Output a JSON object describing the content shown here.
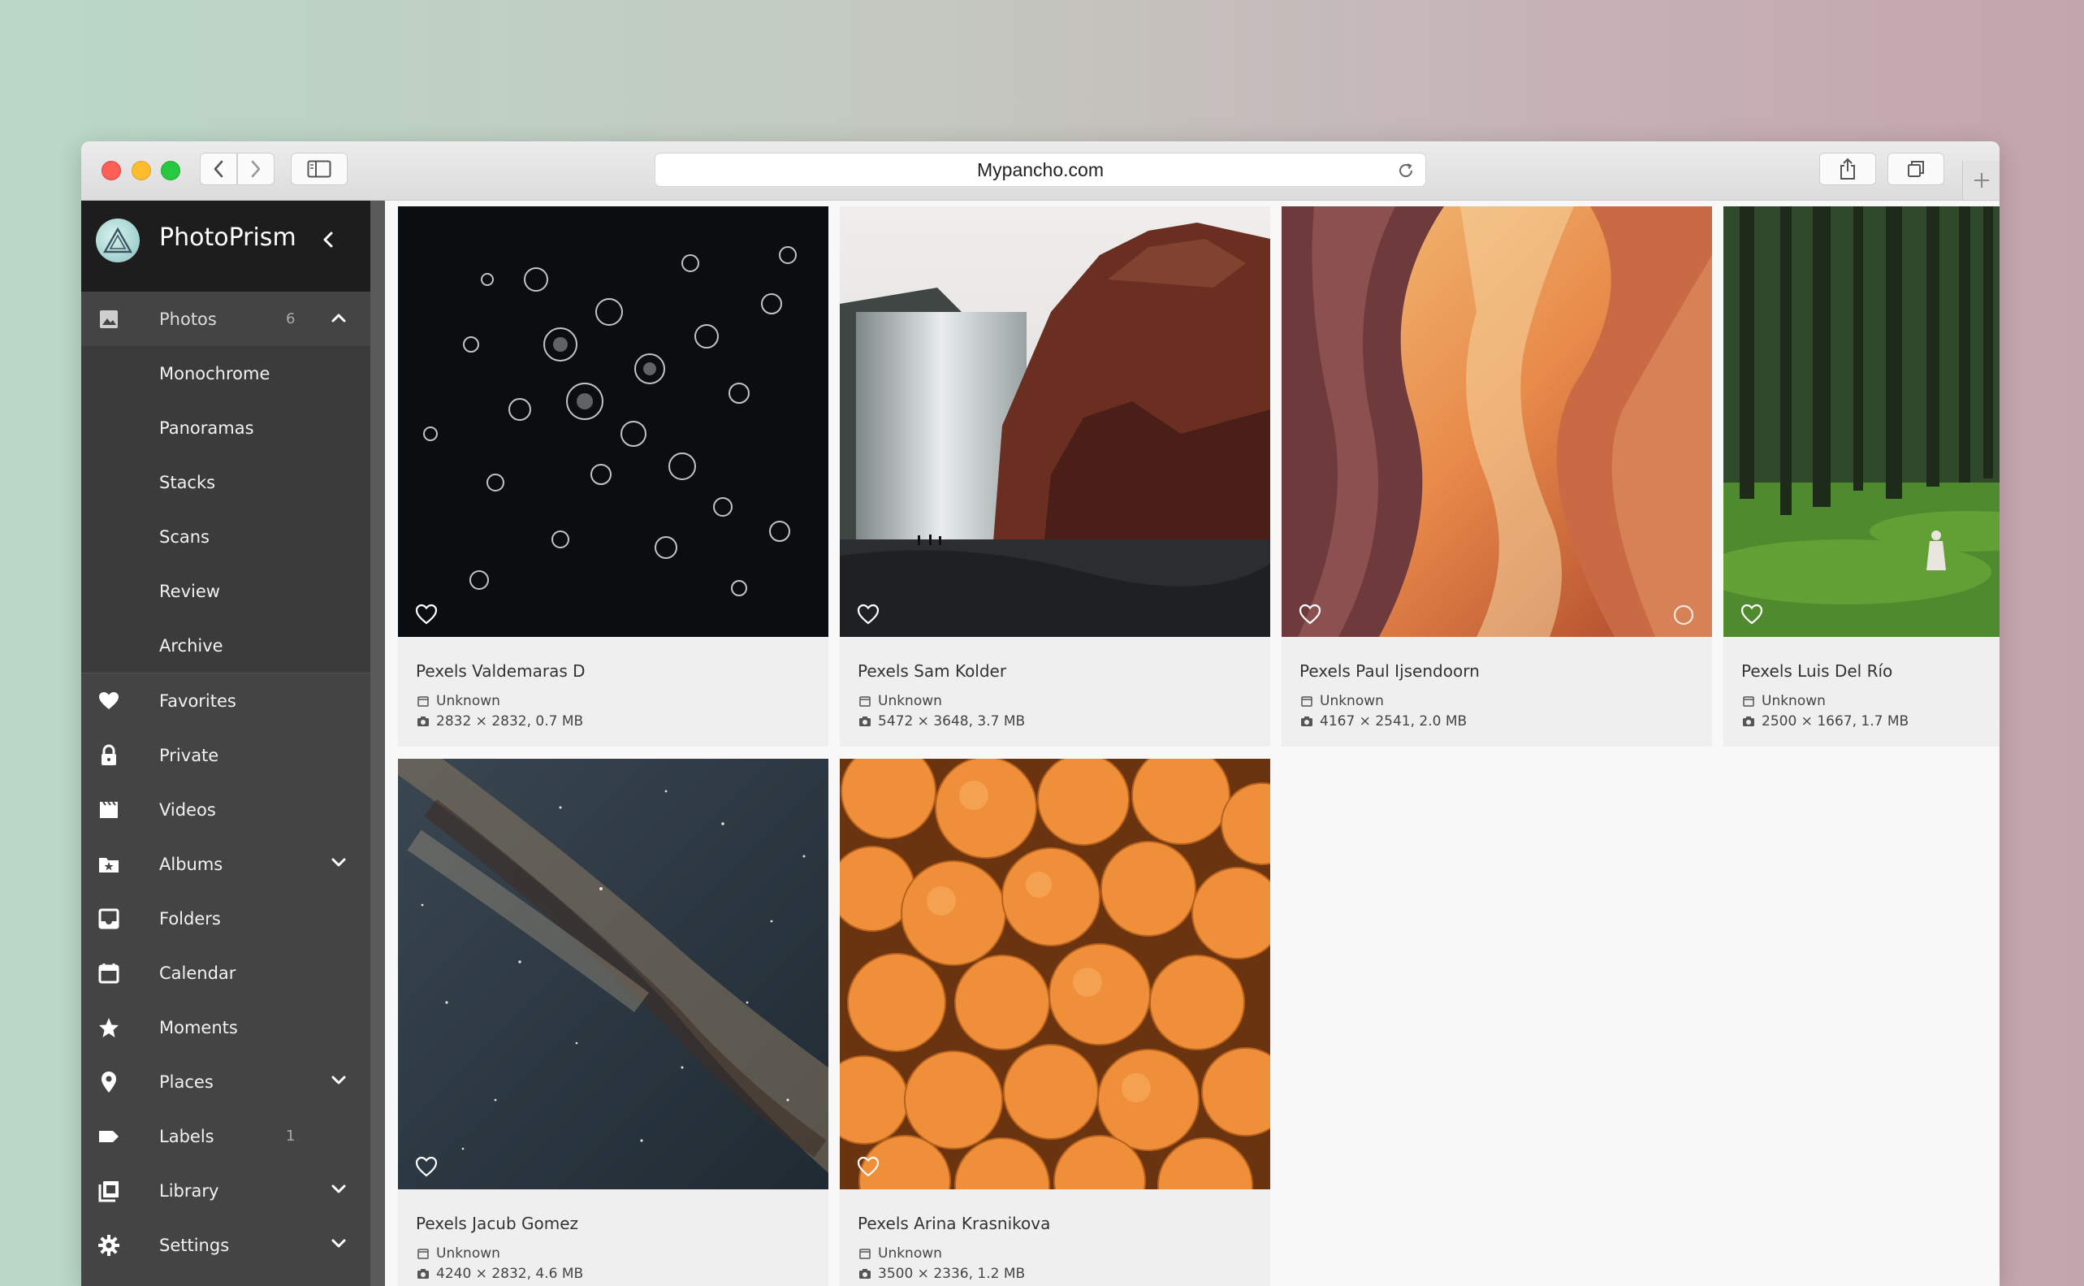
{
  "browser": {
    "url": "Mypancho.com"
  },
  "app": {
    "name": "PhotoPrism"
  },
  "sidebar": {
    "items": [
      {
        "label": "Photos",
        "count": "6",
        "icon": "image-icon",
        "expanded": true
      },
      {
        "label": "Monochrome"
      },
      {
        "label": "Panoramas"
      },
      {
        "label": "Stacks"
      },
      {
        "label": "Scans"
      },
      {
        "label": "Review"
      },
      {
        "label": "Archive"
      },
      {
        "label": "Favorites",
        "icon": "heart-icon"
      },
      {
        "label": "Private",
        "icon": "lock-icon"
      },
      {
        "label": "Videos",
        "icon": "film-icon"
      },
      {
        "label": "Albums",
        "icon": "album-icon"
      },
      {
        "label": "Folders",
        "icon": "folder-icon"
      },
      {
        "label": "Calendar",
        "icon": "calendar-icon"
      },
      {
        "label": "Moments",
        "icon": "star-icon"
      },
      {
        "label": "Places",
        "icon": "map-pin-icon"
      },
      {
        "label": "Labels",
        "count": "1",
        "icon": "label-icon"
      },
      {
        "label": "Library",
        "icon": "library-icon"
      },
      {
        "label": "Settings",
        "icon": "gear-icon"
      }
    ]
  },
  "photos": [
    {
      "title": "Pexels Valdemaras D",
      "date": "Unknown",
      "info": "2832 × 2832, 0.7 MB"
    },
    {
      "title": "Pexels Sam Kolder",
      "date": "Unknown",
      "info": "5472 × 3648, 3.7 MB"
    },
    {
      "title": "Pexels Paul Ijsendoorn",
      "date": "Unknown",
      "info": "4167 × 2541, 2.0 MB"
    },
    {
      "title": "Pexels Luis Del Río",
      "date": "Unknown",
      "info": "2500 × 1667, 1.7 MB"
    },
    {
      "title": "Pexels Jacub Gomez",
      "date": "Unknown",
      "info": "4240 × 2832, 4.6 MB"
    },
    {
      "title": "Pexels Arina Krasnikova",
      "date": "Unknown",
      "info": "3500 × 2336, 1.2 MB"
    }
  ]
}
